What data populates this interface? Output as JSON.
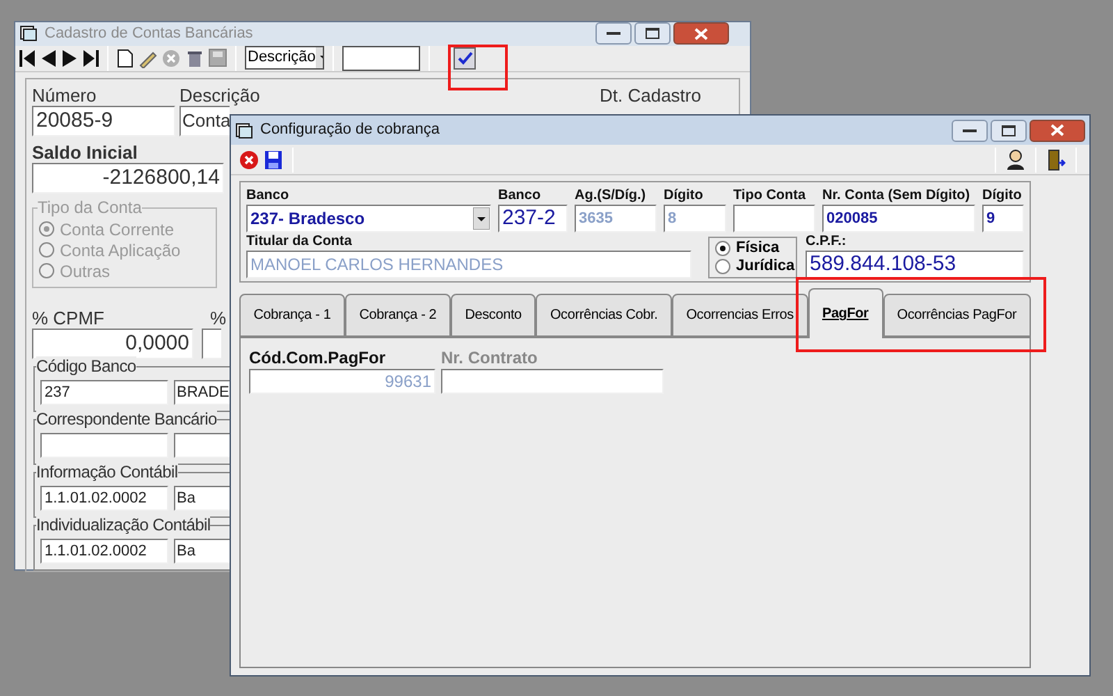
{
  "back_window": {
    "title": "Cadastro de Contas Bancárias",
    "search_mode": "Descrição",
    "numero": {
      "label": "Número",
      "value": "20085-9"
    },
    "descricao": {
      "label": "Descrição",
      "value": "Conta"
    },
    "dt_cadastro": {
      "label": "Dt. Cadastro"
    },
    "saldo_inicial": {
      "label": "Saldo Inicial",
      "value": "-2126800,14"
    },
    "tipo_da_conta": {
      "label": "Tipo da Conta",
      "disabled": true,
      "options": [
        {
          "label": "Conta Corrente",
          "selected": true
        },
        {
          "label": "Conta Aplicação",
          "selected": false
        },
        {
          "label": "Outras",
          "selected": false
        }
      ]
    },
    "cpmf": {
      "label": "% CPMF",
      "value": "0,0000"
    },
    "label_2": "%",
    "codigo_banco": {
      "label": "Código Banco",
      "code": "237",
      "name": "BRADE"
    },
    "correspondente_bancario": {
      "label": "Correspondente Bancário"
    },
    "informacao_contabil": {
      "label": "Informação Contábil",
      "code": "1.1.01.02.0002",
      "name": "Ba"
    },
    "individualizacao_contabil": {
      "label": "Individualização Contábil",
      "code": "1.1.01.02.0002",
      "name": "Ba"
    }
  },
  "front_window": {
    "title": "Configuração de cobrança",
    "fields": [
      {
        "label": "Banco",
        "value": "237- Bradesco",
        "kind": "dropdown",
        "readonly": false
      },
      {
        "label": "Banco",
        "value": "237-2",
        "kind": "large",
        "readonly": false
      },
      {
        "label": "Ag.(S/Díg.)",
        "value": "3635",
        "kind": "text",
        "readonly": true
      },
      {
        "label": "Dígito",
        "value": "8",
        "kind": "text",
        "readonly": true
      },
      {
        "label": "Tipo Conta",
        "kind": "text"
      },
      {
        "label": "Nr. Conta (Sem Dígito)",
        "value": "020085",
        "kind": "text",
        "readonly": false
      },
      {
        "label": "Dígito",
        "value": "9",
        "kind": "text",
        "readonly": false
      }
    ],
    "titular": {
      "label": "Titular da Conta",
      "value": "MANOEL CARLOS HERNANDES",
      "readonly": true
    },
    "pessoa": [
      {
        "label": "Física",
        "selected": true
      },
      {
        "label": "Jurídica",
        "selected": false
      }
    ],
    "cpf": {
      "label": "C.P.F.:",
      "value": "589.844.108-53",
      "readonly": false
    },
    "tabs": [
      {
        "label": "Cobrança - 1",
        "selected": false
      },
      {
        "label": "Cobrança - 2",
        "selected": false
      },
      {
        "label": "Desconto",
        "selected": false
      },
      {
        "label": "Ocorrências Cobr.",
        "selected": false
      },
      {
        "label": "Ocorrencias Erros",
        "selected": false
      },
      {
        "label": "PagFor",
        "selected": true
      },
      {
        "label": "Ocorrências PagFor",
        "selected": false
      }
    ],
    "tab_fields": [
      {
        "label": "Cód.Com.PagFor",
        "value": "99631",
        "disabled": false,
        "readonly": true
      },
      {
        "label": "Nr. Contrato",
        "disabled": true,
        "readonly": false
      }
    ]
  }
}
